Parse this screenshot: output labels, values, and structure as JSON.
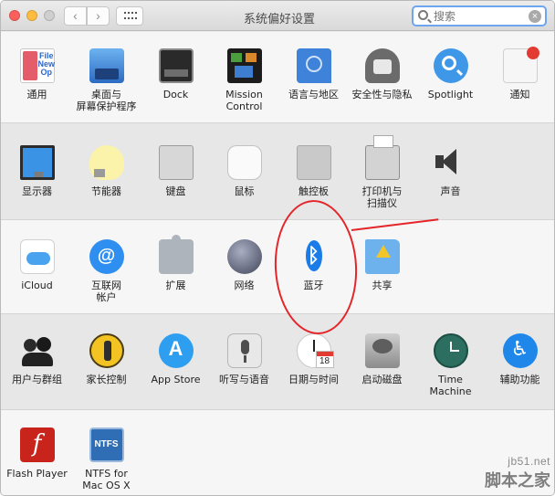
{
  "window": {
    "title": "系统偏好设置",
    "search": {
      "placeholder": "搜索"
    }
  },
  "rows": [
    [
      {
        "label": "通用",
        "icon": "general-icon"
      },
      {
        "label": "桌面与\n屏幕保护程序",
        "icon": "desktop-screensaver-icon"
      },
      {
        "label": "Dock",
        "icon": "dock-icon"
      },
      {
        "label": "Mission\nControl",
        "icon": "mission-control-icon"
      },
      {
        "label": "语言与地区",
        "icon": "language-region-icon"
      },
      {
        "label": "安全性与隐私",
        "icon": "security-privacy-icon"
      },
      {
        "label": "Spotlight",
        "icon": "spotlight-icon"
      },
      {
        "label": "通知",
        "icon": "notifications-icon"
      }
    ],
    [
      {
        "label": "显示器",
        "icon": "displays-icon"
      },
      {
        "label": "节能器",
        "icon": "energy-saver-icon"
      },
      {
        "label": "键盘",
        "icon": "keyboard-icon"
      },
      {
        "label": "鼠标",
        "icon": "mouse-icon"
      },
      {
        "label": "触控板",
        "icon": "trackpad-icon"
      },
      {
        "label": "打印机与\n扫描仪",
        "icon": "printers-scanners-icon"
      },
      {
        "label": "声音",
        "icon": "sound-icon"
      }
    ],
    [
      {
        "label": "iCloud",
        "icon": "icloud-icon"
      },
      {
        "label": "互联网\n帐户",
        "icon": "internet-accounts-icon"
      },
      {
        "label": "扩展",
        "icon": "extensions-icon"
      },
      {
        "label": "网络",
        "icon": "network-icon"
      },
      {
        "label": "蓝牙",
        "icon": "bluetooth-icon"
      },
      {
        "label": "共享",
        "icon": "sharing-icon"
      }
    ],
    [
      {
        "label": "用户与群组",
        "icon": "users-groups-icon"
      },
      {
        "label": "家长控制",
        "icon": "parental-controls-icon"
      },
      {
        "label": "App Store",
        "icon": "app-store-icon"
      },
      {
        "label": "听写与语音",
        "icon": "dictation-speech-icon"
      },
      {
        "label": "日期与时间",
        "icon": "date-time-icon"
      },
      {
        "label": "启动磁盘",
        "icon": "startup-disk-icon"
      },
      {
        "label": "Time Machine",
        "icon": "time-machine-icon"
      },
      {
        "label": "辅助功能",
        "icon": "accessibility-icon"
      }
    ],
    [
      {
        "label": "Flash Player",
        "icon": "flash-player-icon"
      },
      {
        "label": "NTFS for\nMac OS X",
        "icon": "ntfs-icon"
      }
    ]
  ],
  "icon_text": {
    "general": "File\nNew\nOp",
    "internet": "@",
    "app_store": "A",
    "accessibility": "♿",
    "flash": "f",
    "ntfs": "NTFS",
    "calendar_day": "18",
    "bluetooth": "ᛒ"
  },
  "annotation": {
    "target": "蓝牙",
    "color": "#e4262a"
  },
  "watermark": {
    "site": "jb51.net",
    "name": "脚本之家"
  }
}
